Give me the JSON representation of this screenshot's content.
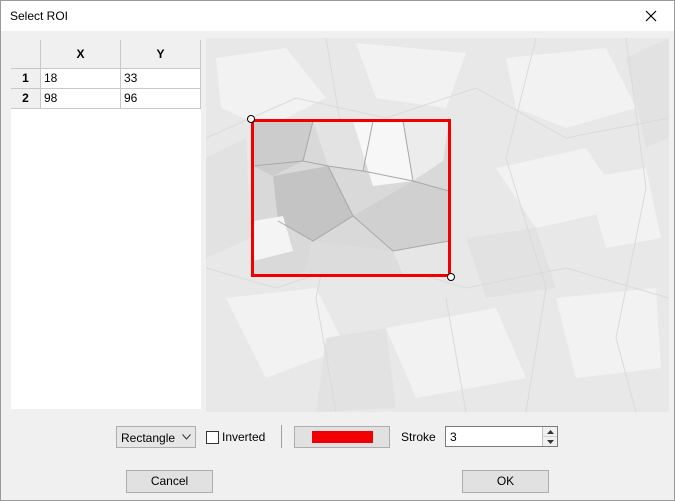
{
  "window": {
    "title": "Select ROI"
  },
  "table": {
    "columns": [
      "X",
      "Y"
    ],
    "rows": [
      {
        "index": "1",
        "x": "18",
        "y": "33"
      },
      {
        "index": "2",
        "x": "98",
        "y": "96"
      }
    ]
  },
  "controls": {
    "shape": "Rectangle",
    "inverted_label": "Inverted",
    "inverted_checked": false,
    "roi_color": "#f00000",
    "stroke_label": "Stroke",
    "stroke_value": "3"
  },
  "buttons": {
    "cancel": "Cancel",
    "ok": "OK"
  }
}
